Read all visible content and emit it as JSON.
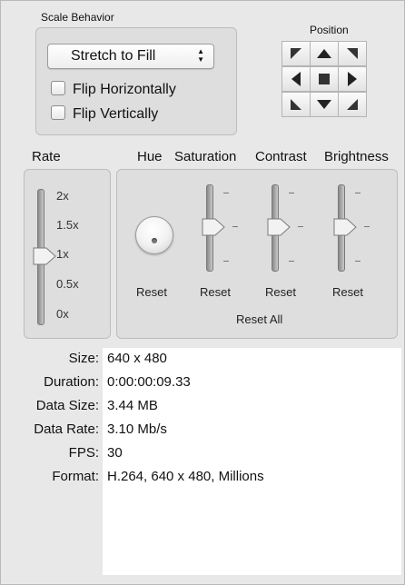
{
  "scale_behavior": {
    "title": "Scale Behavior",
    "popup_value": "Stretch to Fill",
    "flip_horizontally": "Flip Horizontally",
    "flip_vertically": "Flip Vertically"
  },
  "position": {
    "title": "Position"
  },
  "rate": {
    "title": "Rate",
    "ticks": [
      "2x",
      "1.5x",
      "1x",
      "0.5x",
      "0x"
    ],
    "value": "1x"
  },
  "adjustments": {
    "hue_label": "Hue",
    "saturation_label": "Saturation",
    "contrast_label": "Contrast",
    "brightness_label": "Brightness",
    "reset_label": "Reset",
    "reset_all_label": "Reset All"
  },
  "info": {
    "rows": [
      {
        "key": "Size:",
        "value": "640 x 480"
      },
      {
        "key": "Duration:",
        "value": "0:00:00:09.33"
      },
      {
        "key": "Data Size:",
        "value": "3.44 MB"
      },
      {
        "key": "Data Rate:",
        "value": "3.10 Mb/s"
      },
      {
        "key": "FPS:",
        "value": "30"
      },
      {
        "key": "Format:",
        "value": "H.264, 640 x 480, Millions"
      }
    ]
  }
}
